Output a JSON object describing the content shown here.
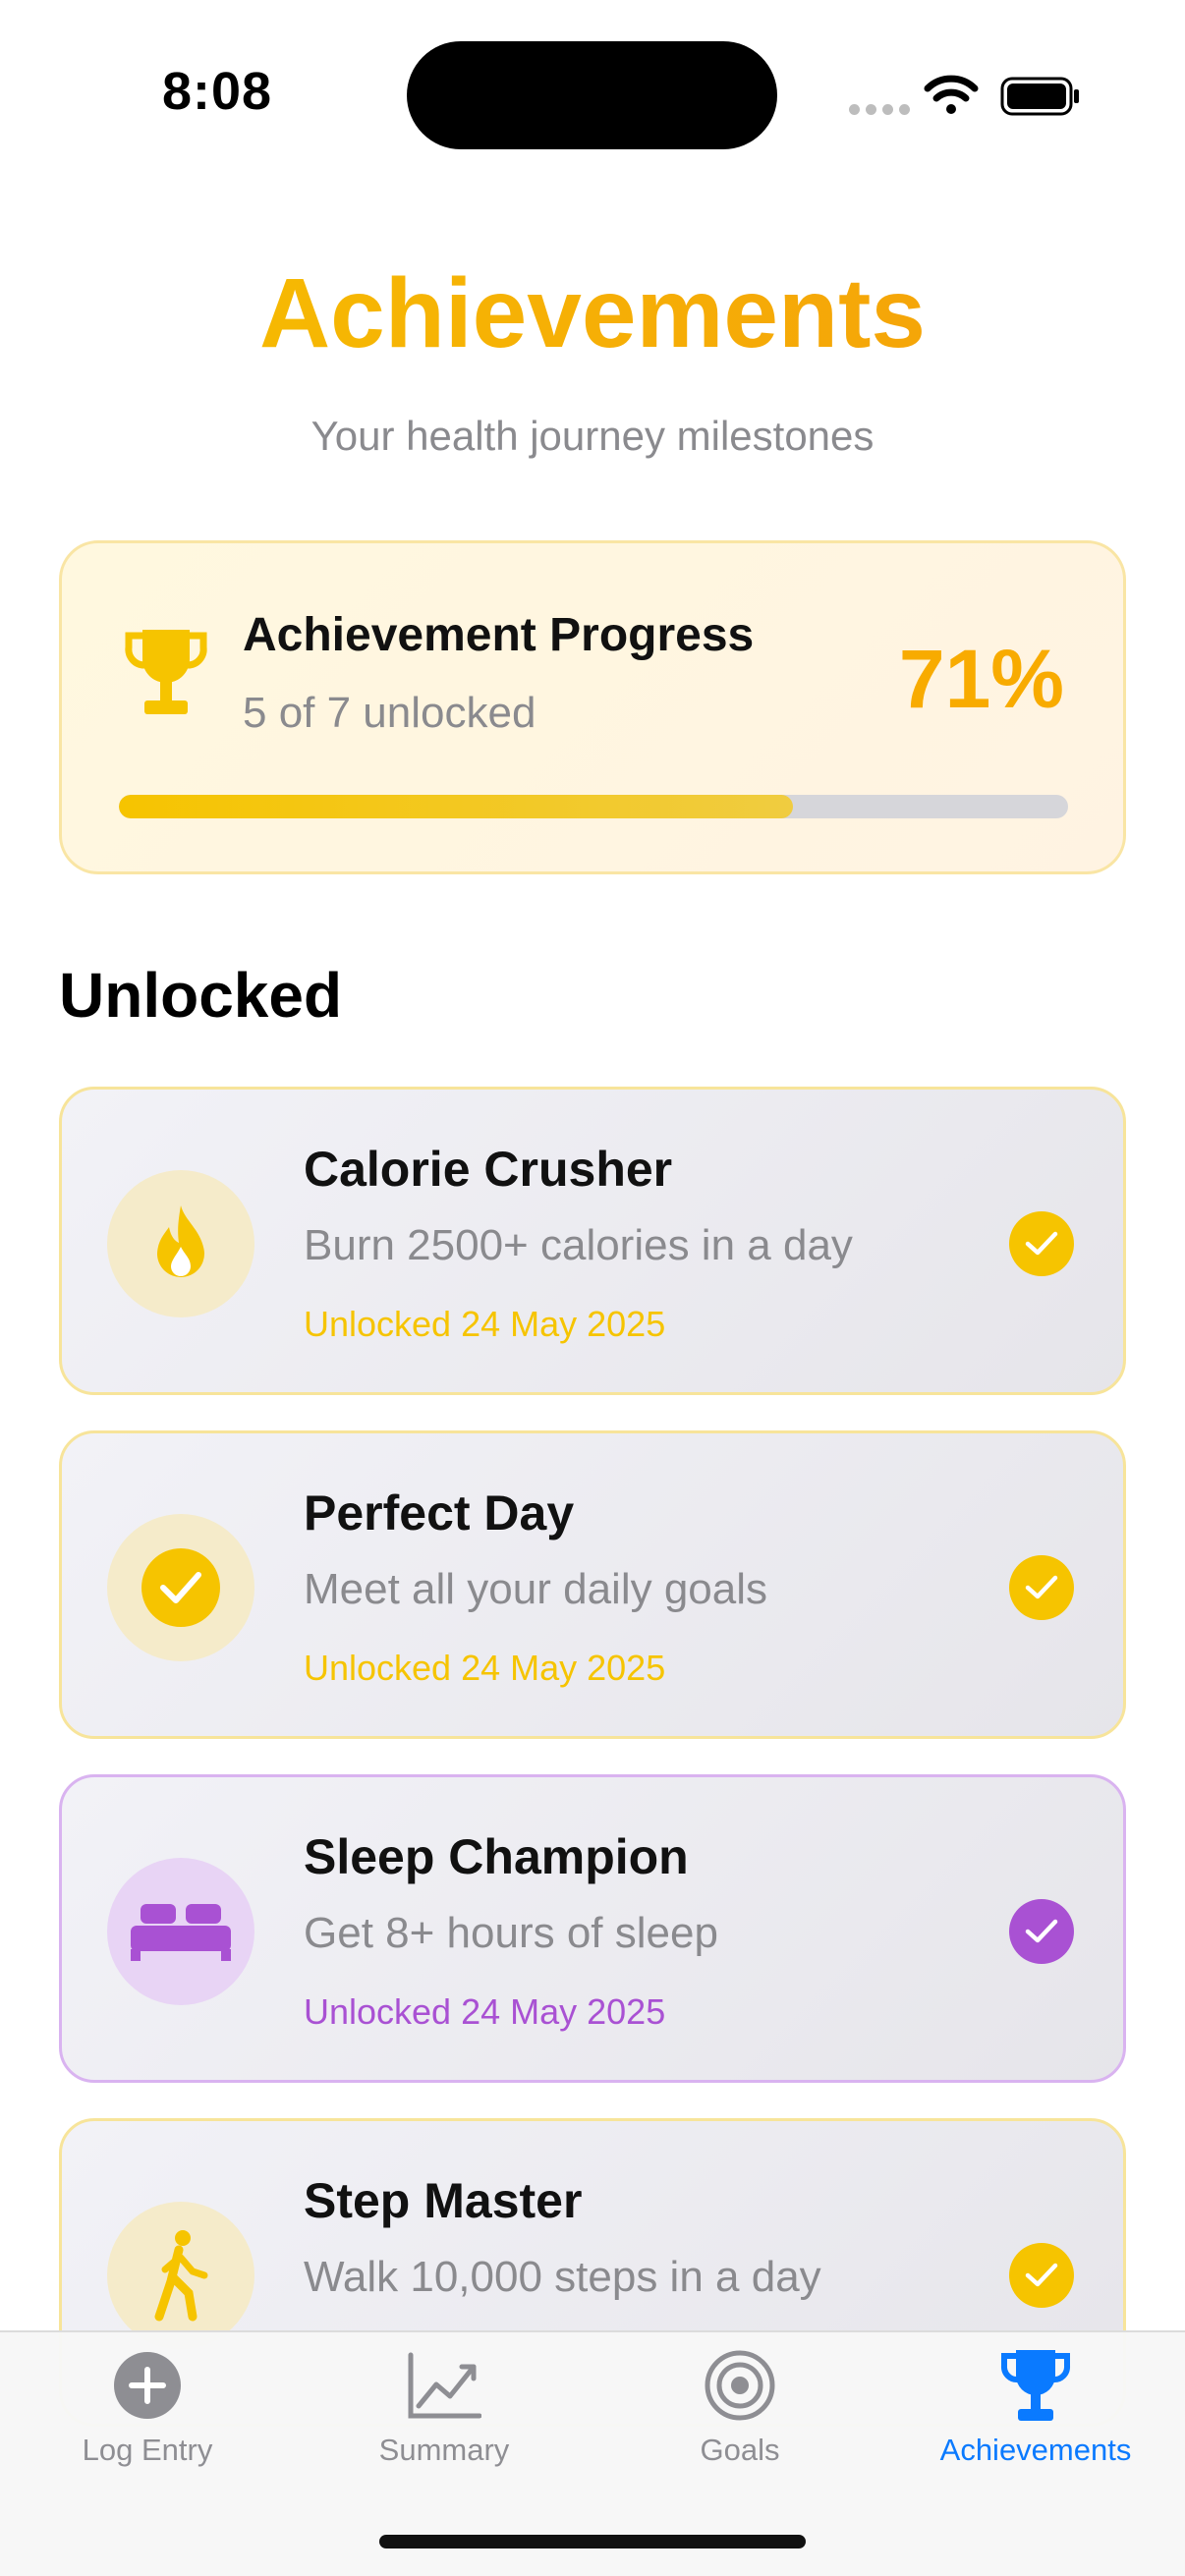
{
  "status_bar": {
    "time": "8:08"
  },
  "header": {
    "title": "Achievements",
    "subtitle": "Your health journey milestones"
  },
  "progress": {
    "title": "Achievement Progress",
    "subtitle": "5 of 7 unlocked",
    "percent_label": "71%",
    "fraction": 0.71
  },
  "section": {
    "title": "Unlocked"
  },
  "achievements": [
    {
      "name": "Calorie Crusher",
      "description": "Burn 2500+ calories in a day",
      "date": "Unlocked 24 May 2025",
      "icon": "flame-icon",
      "color": "#f6c400"
    },
    {
      "name": "Perfect Day",
      "description": "Meet all your daily goals",
      "date": "Unlocked 24 May 2025",
      "icon": "checkmark-circle-icon",
      "color": "#f6c400"
    },
    {
      "name": "Sleep Champion",
      "description": "Get 8+ hours of sleep",
      "date": "Unlocked 24 May 2025",
      "icon": "bed-icon",
      "color": "#a951d3"
    },
    {
      "name": "Step Master",
      "description": "Walk 10,000 steps in a day",
      "icon": "walking-figure-icon",
      "color": "#f6c400"
    }
  ],
  "tabs": [
    {
      "label": "Log Entry",
      "icon": "plus-circle-icon"
    },
    {
      "label": "Summary",
      "icon": "chart-line-icon"
    },
    {
      "label": "Goals",
      "icon": "target-icon"
    },
    {
      "label": "Achievements",
      "icon": "trophy-icon",
      "active": true
    }
  ],
  "colors": {
    "accent_yellow": "#f6c400",
    "accent_orange": "#f59e0b",
    "accent_purple": "#a951d3",
    "tab_active": "#0a7aff"
  }
}
